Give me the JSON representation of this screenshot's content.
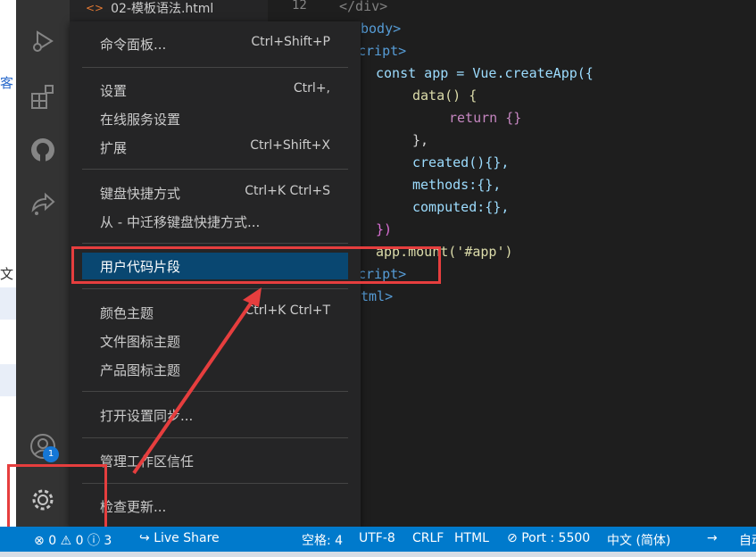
{
  "tab": {
    "icon": "html-file-icon",
    "filename": "02-模板语法.html"
  },
  "left_strip_chars": [
    "客",
    "文"
  ],
  "activity_bar": {
    "badge_count": "1"
  },
  "gutter": {
    "line_number": "12"
  },
  "code": [
    {
      "text": "</div>",
      "color": "#808080"
    },
    {
      "text": "body>",
      "color": "#569cd6"
    },
    {
      "text": "cript>",
      "color": "#569cd6"
    },
    {
      "text": "const app = Vue.createApp({",
      "color": "#9cdcfe"
    },
    {
      "text": "data() {",
      "color": "#dcdcaa"
    },
    {
      "text": "return {}",
      "color": "#c586c0"
    },
    {
      "text": "},",
      "color": "#d4d4d4"
    },
    {
      "text": "created(){},",
      "color": "#9cdcfe"
    },
    {
      "text": "methods:{},",
      "color": "#9cdcfe"
    },
    {
      "text": "computed:{},",
      "color": "#9cdcfe"
    },
    {
      "text": "})",
      "color": "#da70d6"
    },
    {
      "text": "app.mount('#app')",
      "color": "#dcdcaa"
    },
    {
      "text": "cript>",
      "color": "#569cd6"
    },
    {
      "text": "tml>",
      "color": "#569cd6"
    }
  ],
  "menu": {
    "items": [
      {
        "label": "命令面板...",
        "shortcut": "Ctrl+Shift+P"
      },
      {
        "label": "设置",
        "shortcut": "Ctrl+,"
      },
      {
        "label": "在线服务设置",
        "shortcut": ""
      },
      {
        "label": "扩展",
        "shortcut": "Ctrl+Shift+X"
      },
      {
        "label": "键盘快捷方式",
        "shortcut": "Ctrl+K Ctrl+S"
      },
      {
        "label": "从 - 中迁移键盘快捷方式...",
        "shortcut": ""
      },
      {
        "label": "用户代码片段",
        "shortcut": ""
      },
      {
        "label": "颜色主题",
        "shortcut": "Ctrl+K Ctrl+T"
      },
      {
        "label": "文件图标主题",
        "shortcut": ""
      },
      {
        "label": "产品图标主题",
        "shortcut": ""
      },
      {
        "label": "打开设置同步...",
        "shortcut": ""
      },
      {
        "label": "管理工作区信任",
        "shortcut": ""
      },
      {
        "label": "检查更新...",
        "shortcut": ""
      }
    ],
    "active_index": 6
  },
  "status_bar": {
    "errors": "0",
    "warnings": "0",
    "info": "3",
    "live_share": "Live Share",
    "spaces": "空格: 4",
    "encoding": "UTF-8",
    "eol": "CRLF",
    "language": "HTML",
    "port": "Port : 5500",
    "locale": "中文 (简体)",
    "auto": "自动"
  },
  "colors": {
    "accent": "#007acc",
    "menu_active": "#094771",
    "annotation": "#e63e3e"
  }
}
